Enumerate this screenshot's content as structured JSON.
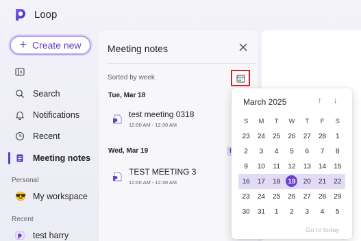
{
  "app": {
    "name": "Loop"
  },
  "sidebar": {
    "create_label": "Create new",
    "items": [
      {
        "label": "",
        "icon": "collapse-sidebar-icon"
      },
      {
        "label": "Search",
        "icon": "search-icon"
      },
      {
        "label": "Notifications",
        "icon": "bell-icon"
      },
      {
        "label": "Recent",
        "icon": "clock-icon"
      },
      {
        "label": "Meeting notes",
        "icon": "notes-icon",
        "active": true
      }
    ],
    "personal_label": "Personal",
    "workspace_label": "My workspace",
    "recent_label": "Recent",
    "recent_item": "test harry"
  },
  "panel": {
    "title": "Meeting notes",
    "sorted_label": "Sorted by week",
    "groups": [
      {
        "day": "Tue, Mar 18",
        "title": "test meeting 0318",
        "time": "12:00 AM - 12:30 AM"
      },
      {
        "day": "Wed, Mar 19",
        "title": "TEST MEETING 3",
        "time": "12:00 AM - 12:30 AM",
        "tag": "T"
      }
    ]
  },
  "calendar": {
    "month": "March 2025",
    "weekdays": [
      "S",
      "M",
      "T",
      "W",
      "T",
      "F",
      "S"
    ],
    "weeks": [
      [
        "23",
        "24",
        "25",
        "26",
        "27",
        "28",
        "1"
      ],
      [
        "2",
        "3",
        "4",
        "5",
        "6",
        "7",
        "8"
      ],
      [
        "9",
        "10",
        "11",
        "12",
        "13",
        "14",
        "15"
      ],
      [
        "16",
        "17",
        "18",
        "19",
        "20",
        "21",
        "22"
      ],
      [
        "23",
        "24",
        "25",
        "26",
        "27",
        "28",
        "29"
      ],
      [
        "30",
        "31",
        "1",
        "2",
        "3",
        "4",
        "5"
      ]
    ],
    "selected_week_index": 3,
    "today": "19",
    "goto_label": "Go to today",
    "accent": "#6a3fd0",
    "selected_week_bg": "#e2dbf7"
  }
}
